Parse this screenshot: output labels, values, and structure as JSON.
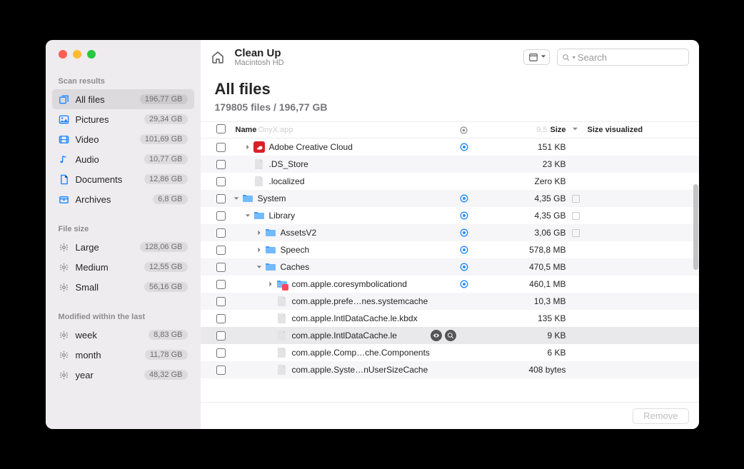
{
  "header": {
    "title": "Clean Up",
    "subtitle": "Macintosh HD",
    "search_placeholder": "Search"
  },
  "sidebar": {
    "sections": [
      {
        "label": "Scan results",
        "items": [
          {
            "icon": "files",
            "label": "All files",
            "badge": "196,77 GB",
            "selected": true
          },
          {
            "icon": "pictures",
            "label": "Pictures",
            "badge": "29,34 GB"
          },
          {
            "icon": "video",
            "label": "Video",
            "badge": "101,69 GB"
          },
          {
            "icon": "audio",
            "label": "Audio",
            "badge": "10,77 GB"
          },
          {
            "icon": "documents",
            "label": "Documents",
            "badge": "12,86 GB"
          },
          {
            "icon": "archives",
            "label": "Archives",
            "badge": "6,8 GB"
          }
        ]
      },
      {
        "label": "File size",
        "items": [
          {
            "icon": "gear",
            "label": "Large",
            "badge": "128,06 GB"
          },
          {
            "icon": "gear",
            "label": "Medium",
            "badge": "12,55 GB"
          },
          {
            "icon": "gear",
            "label": "Small",
            "badge": "56,16 GB"
          }
        ]
      },
      {
        "label": "Modified within the last",
        "items": [
          {
            "icon": "gear",
            "label": "week",
            "badge": "8,83 GB"
          },
          {
            "icon": "gear",
            "label": "month",
            "badge": "11,78 GB"
          },
          {
            "icon": "gear",
            "label": "year",
            "badge": "48,32 GB"
          }
        ]
      }
    ]
  },
  "content": {
    "heading": "All files",
    "subheading": "179805 files / 196,77 GB"
  },
  "table": {
    "columns": {
      "name": "Name",
      "name_ghost": "OnyX.app",
      "size": "Size",
      "size_ghost": "9,5",
      "vis": "Size visualized"
    },
    "rows": [
      {
        "alt": false,
        "depth": 1,
        "disclose": "right",
        "icon": "adobecc",
        "name": "Adobe Creative Cloud",
        "cloud": true,
        "size": "151 KB"
      },
      {
        "alt": true,
        "depth": 1,
        "disclose": "none",
        "icon": "file",
        "name": ".DS_Store",
        "cloud": false,
        "size": "23 KB"
      },
      {
        "alt": false,
        "depth": 1,
        "disclose": "none",
        "icon": "file",
        "name": ".localized",
        "cloud": false,
        "size": "Zero KB"
      },
      {
        "alt": true,
        "depth": 0,
        "disclose": "down",
        "icon": "folder",
        "name": "System",
        "cloud": true,
        "size": "4,35 GB",
        "extraBox": true
      },
      {
        "alt": false,
        "depth": 1,
        "disclose": "down",
        "icon": "folder",
        "name": "Library",
        "cloud": true,
        "size": "4,35 GB",
        "extraBox": true
      },
      {
        "alt": true,
        "depth": 2,
        "disclose": "right",
        "icon": "folder",
        "name": "AssetsV2",
        "cloud": true,
        "size": "3,06 GB",
        "extraBox": true
      },
      {
        "alt": false,
        "depth": 2,
        "disclose": "right",
        "icon": "folder",
        "name": "Speech",
        "cloud": true,
        "size": "578,8 MB"
      },
      {
        "alt": true,
        "depth": 2,
        "disclose": "down",
        "icon": "folder",
        "name": "Caches",
        "cloud": true,
        "size": "470,5 MB"
      },
      {
        "alt": false,
        "depth": 3,
        "disclose": "right",
        "icon": "specialfolder",
        "name": "com.apple.coresymbolicationd",
        "cloud": true,
        "size": "460,1 MB"
      },
      {
        "alt": true,
        "depth": 3,
        "disclose": "none",
        "icon": "file",
        "name": "com.apple.prefe…nes.systemcache",
        "cloud": false,
        "size": "10,3 MB"
      },
      {
        "alt": false,
        "depth": 3,
        "disclose": "none",
        "icon": "file",
        "name": "com.apple.IntlDataCache.le.kbdx",
        "cloud": false,
        "size": "135 KB"
      },
      {
        "alt": true,
        "depth": 3,
        "disclose": "none",
        "icon": "file",
        "name": "com.apple.IntlDataCache.le",
        "cloud": false,
        "size": "9 KB",
        "selected": true,
        "actions": true
      },
      {
        "alt": false,
        "depth": 3,
        "disclose": "none",
        "icon": "file",
        "name": "com.apple.Comp…che.Components",
        "cloud": false,
        "size": "6 KB"
      },
      {
        "alt": true,
        "depth": 3,
        "disclose": "none",
        "icon": "file",
        "name": "com.apple.Syste…nUserSizeCache",
        "cloud": false,
        "size": "408 bytes"
      }
    ]
  },
  "footer": {
    "remove": "Remove"
  }
}
